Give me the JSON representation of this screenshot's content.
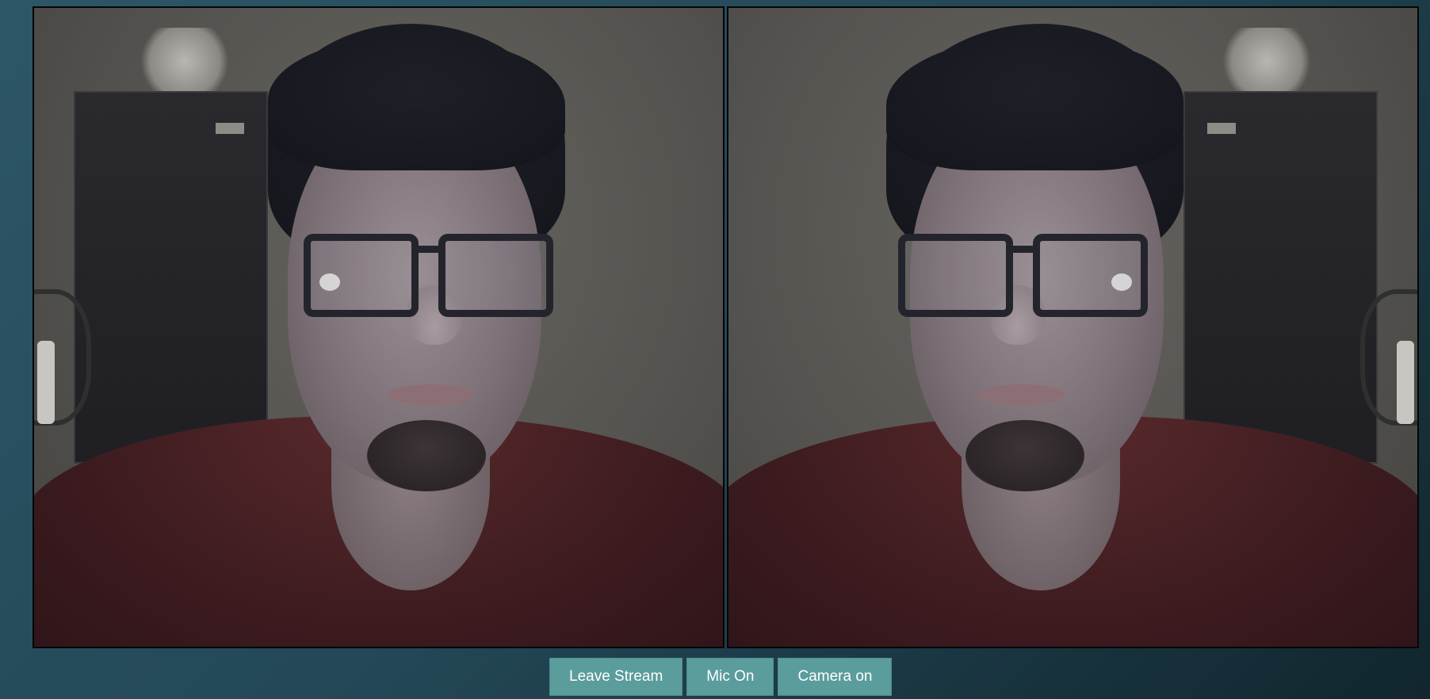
{
  "video_tiles": [
    {
      "id": "local",
      "mirrored": false
    },
    {
      "id": "remote",
      "mirrored": true
    }
  ],
  "controls": {
    "leave_label": "Leave Stream",
    "mic_label": "Mic On",
    "camera_label": "Camera on"
  },
  "colors": {
    "button_bg": "#5b9c9c",
    "button_text": "#ffffff",
    "page_gradient_start": "#2d5667",
    "page_gradient_end": "#11262e"
  }
}
